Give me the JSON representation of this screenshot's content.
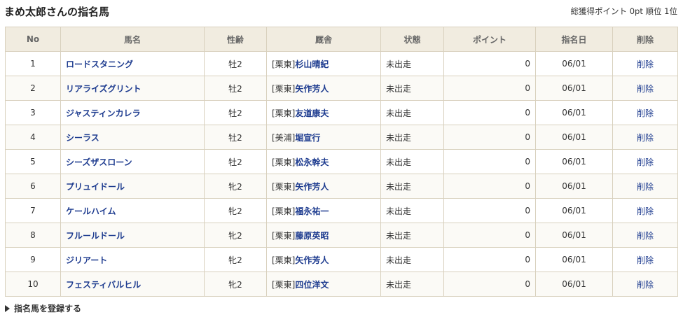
{
  "header": {
    "title": "まめ太郎さんの指名馬",
    "total_points_label": "総獲得ポイント",
    "total_points": "0pt",
    "rank_label": "順位",
    "rank": "1位"
  },
  "table": {
    "columns": [
      "No",
      "馬名",
      "性齢",
      "厩舎",
      "状態",
      "ポイント",
      "指名日",
      "削除"
    ],
    "rows": [
      {
        "no": "1",
        "horse": "ロードスタニング",
        "sexage": "牡2",
        "region": "[栗東]",
        "trainer": "杉山晴紀",
        "status": "未出走",
        "points": "0",
        "date": "06/01",
        "delete": "削除"
      },
      {
        "no": "2",
        "horse": "リアライズグリント",
        "sexage": "牡2",
        "region": "[栗東]",
        "trainer": "矢作芳人",
        "status": "未出走",
        "points": "0",
        "date": "06/01",
        "delete": "削除"
      },
      {
        "no": "3",
        "horse": "ジャスティンカレラ",
        "sexage": "牡2",
        "region": "[栗東]",
        "trainer": "友道康夫",
        "status": "未出走",
        "points": "0",
        "date": "06/01",
        "delete": "削除"
      },
      {
        "no": "4",
        "horse": "シーラス",
        "sexage": "牡2",
        "region": "[美浦]",
        "trainer": "堀宣行",
        "status": "未出走",
        "points": "0",
        "date": "06/01",
        "delete": "削除"
      },
      {
        "no": "5",
        "horse": "シーズザスローン",
        "sexage": "牡2",
        "region": "[栗東]",
        "trainer": "松永幹夫",
        "status": "未出走",
        "points": "0",
        "date": "06/01",
        "delete": "削除"
      },
      {
        "no": "6",
        "horse": "プリュイドール",
        "sexage": "牝2",
        "region": "[栗東]",
        "trainer": "矢作芳人",
        "status": "未出走",
        "points": "0",
        "date": "06/01",
        "delete": "削除"
      },
      {
        "no": "7",
        "horse": "ケールハイム",
        "sexage": "牝2",
        "region": "[栗東]",
        "trainer": "福永祐一",
        "status": "未出走",
        "points": "0",
        "date": "06/01",
        "delete": "削除"
      },
      {
        "no": "8",
        "horse": "フルールドール",
        "sexage": "牝2",
        "region": "[栗東]",
        "trainer": "藤原英昭",
        "status": "未出走",
        "points": "0",
        "date": "06/01",
        "delete": "削除"
      },
      {
        "no": "9",
        "horse": "ジリアート",
        "sexage": "牝2",
        "region": "[栗東]",
        "trainer": "矢作芳人",
        "status": "未出走",
        "points": "0",
        "date": "06/01",
        "delete": "削除"
      },
      {
        "no": "10",
        "horse": "フェスティバルヒル",
        "sexage": "牝2",
        "region": "[栗東]",
        "trainer": "四位洋文",
        "status": "未出走",
        "points": "0",
        "date": "06/01",
        "delete": "削除"
      }
    ]
  },
  "footer": {
    "register_link": "指名馬を登録する",
    "register_icon": "triangle-right-icon"
  },
  "colors": {
    "link": "#1d3b8f",
    "header_bg": "#f1ece0",
    "border": "#d8d0bd"
  }
}
